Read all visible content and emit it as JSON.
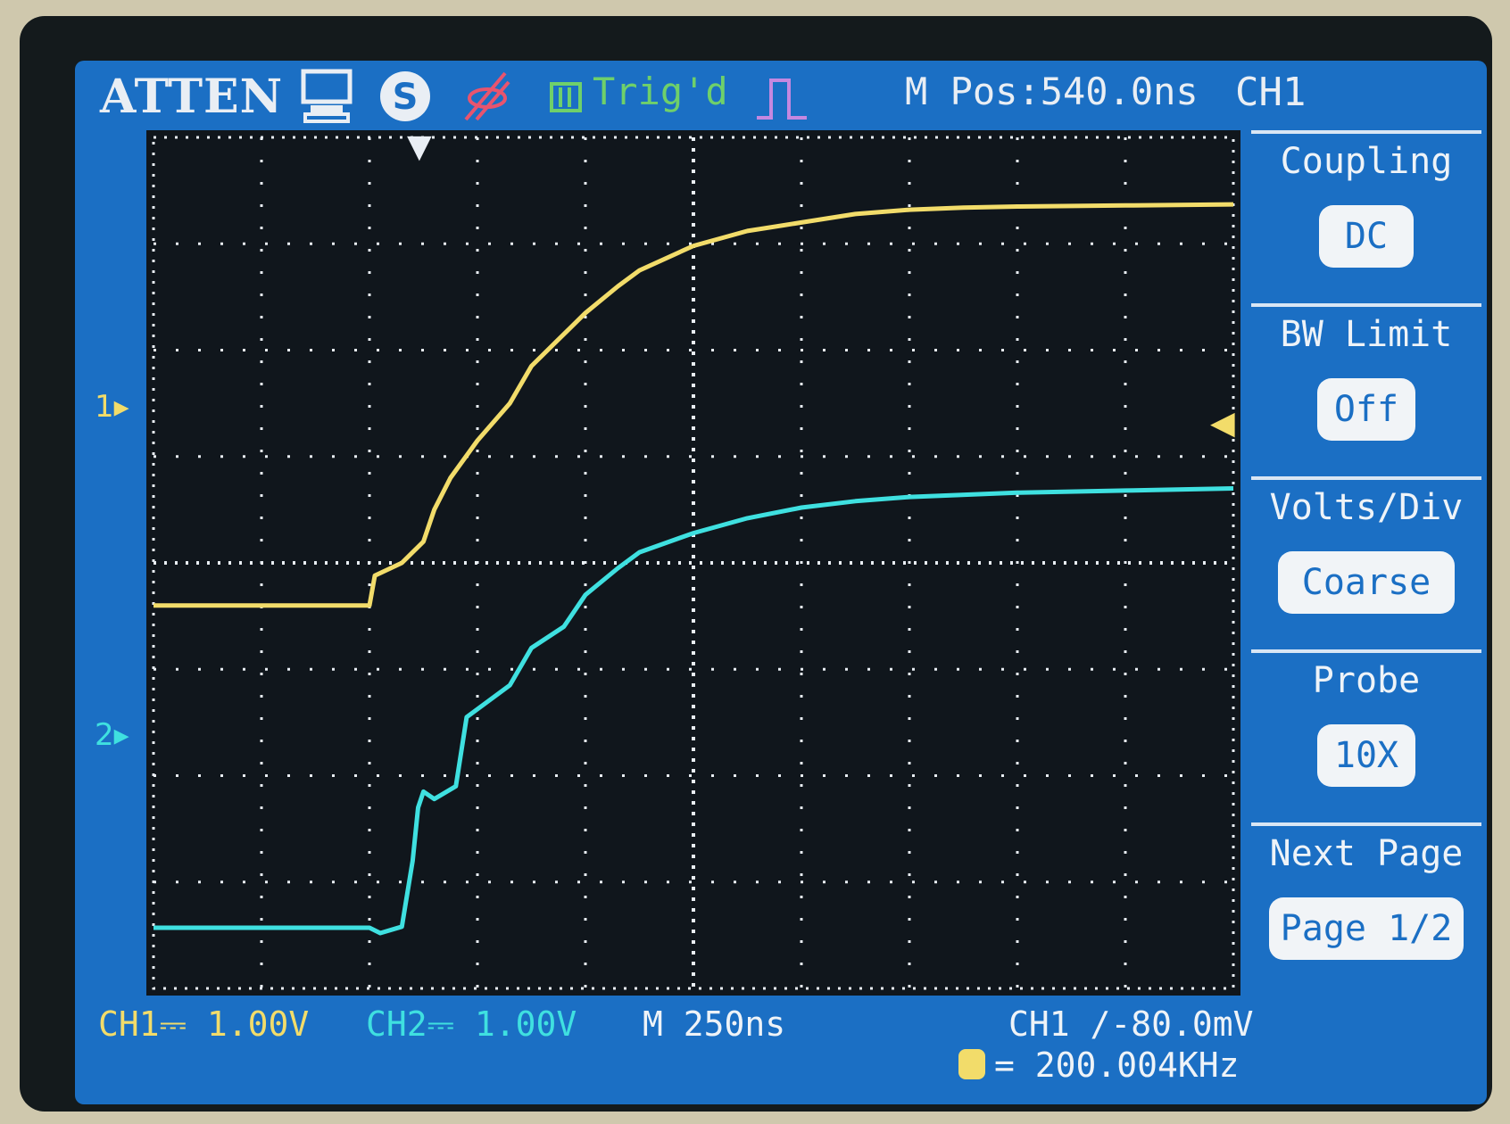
{
  "header": {
    "brand": "ATTEN",
    "status": "Trig'd",
    "mpos": "M Pos:540.0ns",
    "channel": "CH1"
  },
  "icons": [
    "display-icon",
    "save-icon",
    "probe-check-icon",
    "trigger-status-icon",
    "pulse-edge-icon"
  ],
  "markers": {
    "ch1": "1",
    "ch2": "2"
  },
  "menu": {
    "sections": [
      {
        "title": "Coupling",
        "value": "DC"
      },
      {
        "title": "BW Limit",
        "value": "Off"
      },
      {
        "title": "Volts/Div",
        "value": "Coarse"
      },
      {
        "title": "Probe",
        "value": "10X"
      },
      {
        "title": "Next Page",
        "value": "Page 1/2"
      }
    ]
  },
  "status_bar": {
    "ch1": "CH1⎓ 1.00V",
    "ch2": "CH2⎓ 1.00V",
    "timebase": "M 250ns",
    "trigger": "CH1 ∕-80.0mV",
    "freq": "= 200.004KHz"
  },
  "colors": {
    "ch1": "#f2dc6a",
    "ch2": "#3fe0e0",
    "screen": "#1b6fc4",
    "grid_bg": "#10161c"
  },
  "chart_data": {
    "type": "line",
    "grid": true,
    "divisions": {
      "x": 10,
      "y": 8
    },
    "x_unit": "div",
    "y_unit": "div",
    "series": [
      {
        "name": "CH1",
        "color": "#f2dc6a",
        "x": [
          0,
          1,
          2.0,
          2.05,
          2.3,
          2.5,
          2.6,
          2.75,
          3.0,
          3.3,
          3.5,
          3.7,
          4.0,
          4.3,
          4.5,
          5.0,
          5.5,
          6.0,
          6.5,
          7.0,
          7.5,
          8.0,
          9.0,
          10.0
        ],
        "y": [
          3.6,
          3.6,
          3.6,
          3.88,
          4.0,
          4.2,
          4.5,
          4.8,
          5.15,
          5.5,
          5.85,
          6.05,
          6.35,
          6.6,
          6.75,
          6.98,
          7.12,
          7.2,
          7.28,
          7.32,
          7.34,
          7.35,
          7.36,
          7.37
        ]
      },
      {
        "name": "CH2",
        "color": "#3fe0e0",
        "x": [
          0,
          1,
          2.0,
          2.1,
          2.3,
          2.4,
          2.45,
          2.5,
          2.6,
          2.8,
          2.9,
          3.1,
          3.3,
          3.5,
          3.8,
          4.0,
          4.3,
          4.5,
          5.0,
          5.5,
          6.0,
          6.5,
          7.0,
          8.0,
          9.0,
          10.0
        ],
        "y": [
          0.57,
          0.57,
          0.57,
          0.52,
          0.58,
          1.2,
          1.7,
          1.85,
          1.78,
          1.9,
          2.55,
          2.7,
          2.85,
          3.2,
          3.4,
          3.7,
          3.95,
          4.1,
          4.28,
          4.42,
          4.52,
          4.58,
          4.62,
          4.66,
          4.68,
          4.7
        ]
      }
    ]
  }
}
